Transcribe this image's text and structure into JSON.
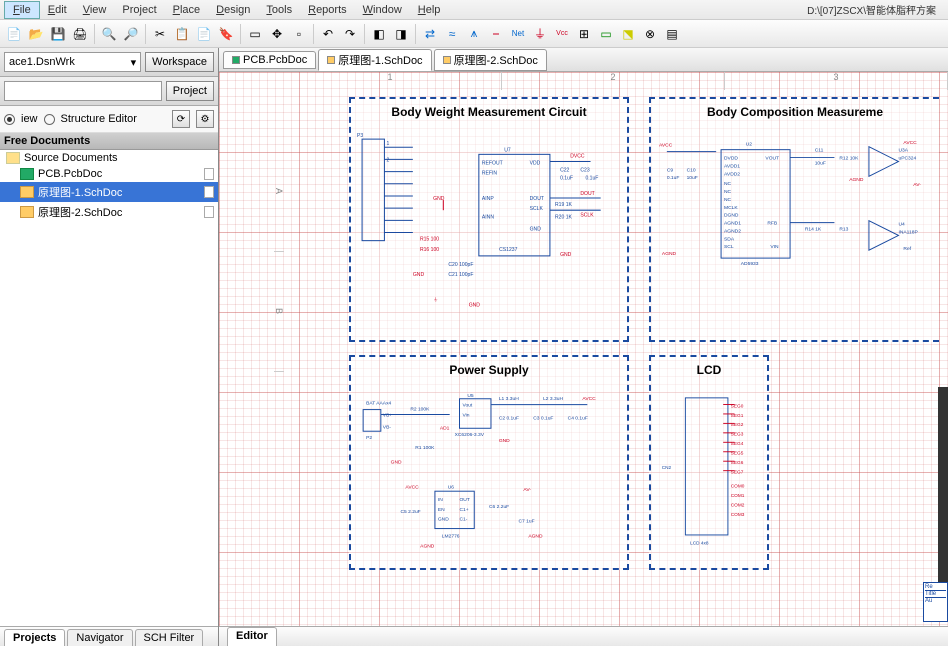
{
  "menu": {
    "items": [
      "File",
      "Edit",
      "View",
      "Project",
      "Place",
      "Design",
      "Tools",
      "Reports",
      "Window",
      "Help"
    ],
    "path": "D:\\[07]ZSCX\\智能体脂秤方案"
  },
  "sidebar": {
    "workspace_combo": "ace1.DsnWrk",
    "workspace_btn": "Workspace",
    "project_btn": "Project",
    "view_radio": "iew",
    "struct_radio": "Structure Editor",
    "tree_head": "Free Documents",
    "tree": [
      {
        "label": "Source Documents",
        "icon": "folder",
        "sel": false,
        "sheet": false,
        "indent": 0
      },
      {
        "label": "PCB.PcbDoc",
        "icon": "pcb",
        "sel": false,
        "sheet": true,
        "indent": 1
      },
      {
        "label": "原理图-1.SchDoc",
        "icon": "sch",
        "sel": true,
        "sheet": true,
        "indent": 1
      },
      {
        "label": "原理图-2.SchDoc",
        "icon": "sch",
        "sel": false,
        "sheet": true,
        "indent": 1
      }
    ],
    "bottom_tabs": [
      "Projects",
      "Navigator",
      "SCH Filter"
    ]
  },
  "doc_tabs": [
    {
      "label": "PCB.PcbDoc",
      "icon": "pcb",
      "active": false
    },
    {
      "label": "原理图-1.SchDoc",
      "icon": "sch",
      "active": true
    },
    {
      "label": "原理图-2.SchDoc",
      "icon": "sch",
      "active": false
    }
  ],
  "circuits": {
    "a": {
      "title": "Body Weight Measurement Circuit"
    },
    "b": {
      "title": "Body Composition Measureme"
    },
    "c": {
      "title": "Power Supply"
    },
    "d": {
      "title": "LCD"
    }
  },
  "ruler_h": [
    "1",
    "2",
    "3"
  ],
  "ruler_v": [
    "A",
    "B"
  ],
  "editor_tab": "Editor",
  "chart_data": null
}
